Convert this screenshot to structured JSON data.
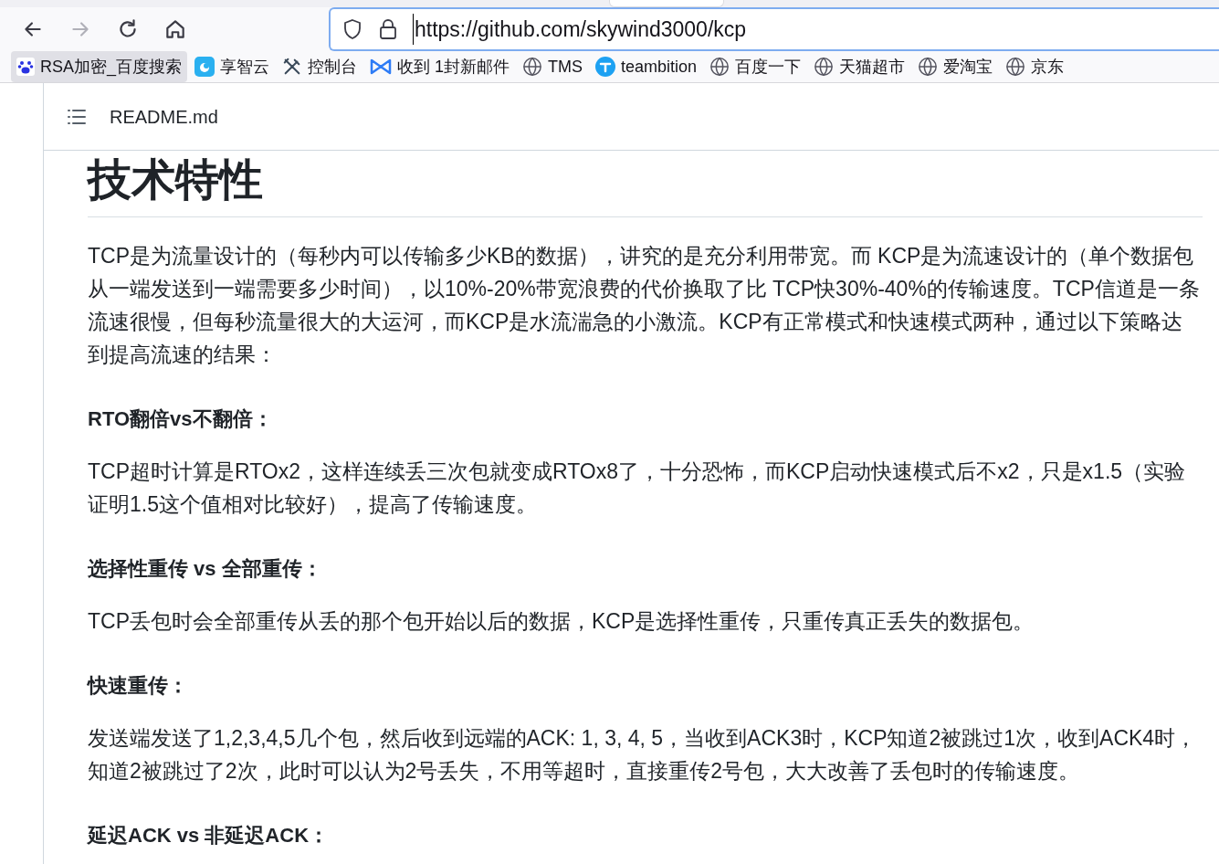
{
  "toolbar": {
    "buttons": [
      {
        "kind": "back",
        "disabled": false
      },
      {
        "kind": "forward",
        "disabled": true
      },
      {
        "kind": "reload",
        "disabled": false
      },
      {
        "kind": "home",
        "disabled": false
      }
    ],
    "url": "https://github.com/skywind3000/kcp"
  },
  "bookmarks": [
    {
      "label": "RSA加密_百度搜索",
      "kind": "paw",
      "selected": true
    },
    {
      "label": "享智云",
      "kind": "cloud",
      "selected": false
    },
    {
      "label": "控制台",
      "kind": "tools",
      "selected": false
    },
    {
      "label": "收到 1封新邮件",
      "kind": "mail",
      "selected": false
    },
    {
      "label": "TMS",
      "kind": "globe",
      "selected": false
    },
    {
      "label": "teambition",
      "kind": "team",
      "selected": false
    },
    {
      "label": "百度一下",
      "kind": "globe",
      "selected": false
    },
    {
      "label": "天猫超市",
      "kind": "globe",
      "selected": false
    },
    {
      "label": "爱淘宝",
      "kind": "globe",
      "selected": false
    },
    {
      "label": "京东",
      "kind": "globe",
      "selected": false
    }
  ],
  "readme": {
    "filename": "README.md",
    "title": "技术特性",
    "blocks": [
      {
        "kind": "paragraph",
        "text": "TCP是为流量设计的（每秒内可以传输多少KB的数据），讲究的是充分利用带宽。而 KCP是为流速设计的（单个数据包从一端发送到一端需要多少时间），以10%-20%带宽浪费的代价换取了比 TCP快30%-40%的传输速度。TCP信道是一条流速很慢，但每秒流量很大的大运河，而KCP是水流湍急的小激流。KCP有正常模式和快速模式两种，通过以下策略达到提高流速的结果："
      },
      {
        "kind": "heading",
        "text": "RTO翻倍vs不翻倍："
      },
      {
        "kind": "paragraph",
        "text": "TCP超时计算是RTOx2，这样连续丢三次包就变成RTOx8了，十分恐怖，而KCP启动快速模式后不x2，只是x1.5（实验证明1.5这个值相对比较好），提高了传输速度。"
      },
      {
        "kind": "heading",
        "text": "选择性重传 vs 全部重传："
      },
      {
        "kind": "paragraph",
        "text": "TCP丢包时会全部重传从丢的那个包开始以后的数据，KCP是选择性重传，只重传真正丢失的数据包。"
      },
      {
        "kind": "heading",
        "text": "快速重传："
      },
      {
        "kind": "paragraph",
        "text": "发送端发送了1,2,3,4,5几个包，然后收到远端的ACK: 1, 3, 4, 5，当收到ACK3时，KCP知道2被跳过1次，收到ACK4时，知道2被跳过了2次，此时可以认为2号丢失，不用等超时，直接重传2号包，大大改善了丢包时的传输速度。"
      },
      {
        "kind": "heading",
        "text": "延迟ACK vs 非延迟ACK："
      }
    ]
  }
}
